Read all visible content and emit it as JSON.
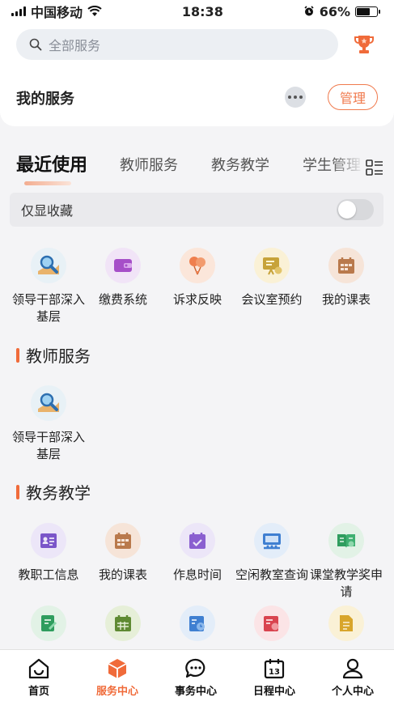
{
  "status_bar": {
    "carrier": "中国移动",
    "time": "18:38",
    "battery": "66%",
    "battery_level": 0.66
  },
  "search": {
    "placeholder": "全部服务",
    "icon": "search-icon"
  },
  "header": {
    "my_services": "我的服务",
    "manage_label": "管理"
  },
  "tabs": [
    {
      "label": "最近使用",
      "active": true
    },
    {
      "label": "教师服务",
      "active": false
    },
    {
      "label": "教务教学",
      "active": false
    },
    {
      "label": "学生管理",
      "active": false
    }
  ],
  "favorites_only": {
    "label": "仅显收藏",
    "enabled": false
  },
  "recent_apps": [
    {
      "label": "领导干部深入基层",
      "icon": "magnifier-icon",
      "color": "#e8f1f6"
    },
    {
      "label": "缴费系统",
      "icon": "wallet-icon",
      "color": "#f1e4f7"
    },
    {
      "label": "诉求反映",
      "icon": "balloons-icon",
      "color": "#fbe6da"
    },
    {
      "label": "会议室预约",
      "icon": "presentation-icon",
      "color": "#faf1d6"
    },
    {
      "label": "我的课表",
      "icon": "timetable-icon",
      "color": "#f6e4d8"
    }
  ],
  "sections": [
    {
      "title": "教师服务",
      "apps": [
        {
          "label": "领导干部深入基层",
          "icon": "magnifier-icon",
          "color": "#e8f1f6"
        }
      ]
    },
    {
      "title": "教务教学",
      "apps": [
        {
          "label": "教职工信息",
          "icon": "staff-card-icon",
          "color": "#ece6f8"
        },
        {
          "label": "我的课表",
          "icon": "timetable-icon",
          "color": "#f6e4d8"
        },
        {
          "label": "作息时间",
          "icon": "calendar-icon",
          "color": "#ece6f8"
        },
        {
          "label": "空闲教室查询",
          "icon": "classroom-icon",
          "color": "#e3edf9"
        },
        {
          "label": "课堂教学奖申请",
          "icon": "award-book-icon",
          "color": "#e2f2e6"
        }
      ],
      "apps_row2_icons": [
        {
          "icon": "edit-doc-icon",
          "color": "#e2f2e6"
        },
        {
          "icon": "calendar-grid-icon",
          "color": "#e6efd8"
        },
        {
          "icon": "schedule-check-icon",
          "color": "#e3edf9"
        },
        {
          "icon": "list-search-icon",
          "color": "#fbe4e6"
        },
        {
          "icon": "document-icon",
          "color": "#faf1d6"
        }
      ]
    }
  ],
  "bottom_nav": [
    {
      "label": "首页",
      "icon": "home-icon",
      "active": false
    },
    {
      "label": "服务中心",
      "icon": "cube-icon",
      "active": true
    },
    {
      "label": "事务中心",
      "icon": "chat-bubble-icon",
      "active": false
    },
    {
      "label": "日程中心",
      "icon": "calendar-13-icon",
      "active": false
    },
    {
      "label": "个人中心",
      "icon": "person-icon",
      "active": false
    }
  ],
  "colors": {
    "accent": "#f06b3a",
    "background": "#f4f4f6"
  }
}
